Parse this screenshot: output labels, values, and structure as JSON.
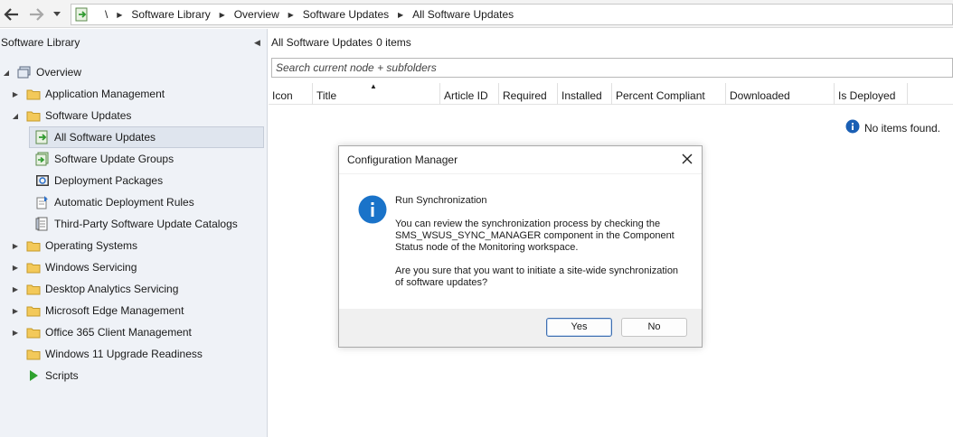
{
  "addressbar": {
    "root": "\\",
    "breadcrumbs": [
      "Software Library",
      "Overview",
      "Software Updates",
      "All Software Updates"
    ]
  },
  "leftpanel": {
    "title": "Software Library",
    "tree": [
      {
        "label": "Overview",
        "icon": "overview-icon",
        "expanded": true,
        "level": 0
      },
      {
        "label": "Application Management",
        "icon": "folder-icon",
        "expanded": false,
        "level": 1
      },
      {
        "label": "Software Updates",
        "icon": "folder-icon",
        "expanded": true,
        "level": 1
      },
      {
        "label": "All Software Updates",
        "icon": "software-update-icon",
        "level": 2,
        "selected": true
      },
      {
        "label": "Software Update Groups",
        "icon": "update-group-icon",
        "level": 2
      },
      {
        "label": "Deployment Packages",
        "icon": "package-icon",
        "level": 2
      },
      {
        "label": "Automatic Deployment Rules",
        "icon": "rule-icon",
        "level": 2
      },
      {
        "label": "Third-Party Software Update Catalogs",
        "icon": "catalog-icon",
        "level": 2
      },
      {
        "label": "Operating Systems",
        "icon": "folder-icon",
        "expanded": false,
        "level": 1
      },
      {
        "label": "Windows Servicing",
        "icon": "folder-icon",
        "expanded": false,
        "level": 1
      },
      {
        "label": "Desktop Analytics Servicing",
        "icon": "folder-icon",
        "expanded": false,
        "level": 1
      },
      {
        "label": "Microsoft Edge Management",
        "icon": "folder-icon",
        "expanded": false,
        "level": 1
      },
      {
        "label": "Office 365 Client Management",
        "icon": "folder-icon",
        "expanded": false,
        "level": 1
      },
      {
        "label": "Windows 11 Upgrade Readiness",
        "icon": "folder-icon",
        "level": 1
      },
      {
        "label": "Scripts",
        "icon": "script-icon",
        "level": 1
      }
    ]
  },
  "content": {
    "title": "All Software Updates",
    "count": "0 items",
    "search_placeholder": "Search current node + subfolders",
    "columns": [
      "Icon",
      "Title",
      "Article ID",
      "Required",
      "Installed",
      "Percent Compliant",
      "Downloaded",
      "Is Deployed"
    ],
    "empty_message": "No items found."
  },
  "dialog": {
    "title": "Configuration Manager",
    "heading": "Run Synchronization",
    "paragraph1": "You can review the synchronization process by checking the SMS_WSUS_SYNC_MANAGER component in the Component Status node of the Monitoring workspace.",
    "paragraph2": "Are you sure that you want to initiate a site-wide synchronization of software updates?",
    "yes_label": "Yes",
    "no_label": "No"
  },
  "colors": {
    "panel_bg": "#eff2f7",
    "selected_bg": "#dfe5ee",
    "info_blue": "#1a73c9",
    "folder_yellow": "#f3c95a"
  }
}
